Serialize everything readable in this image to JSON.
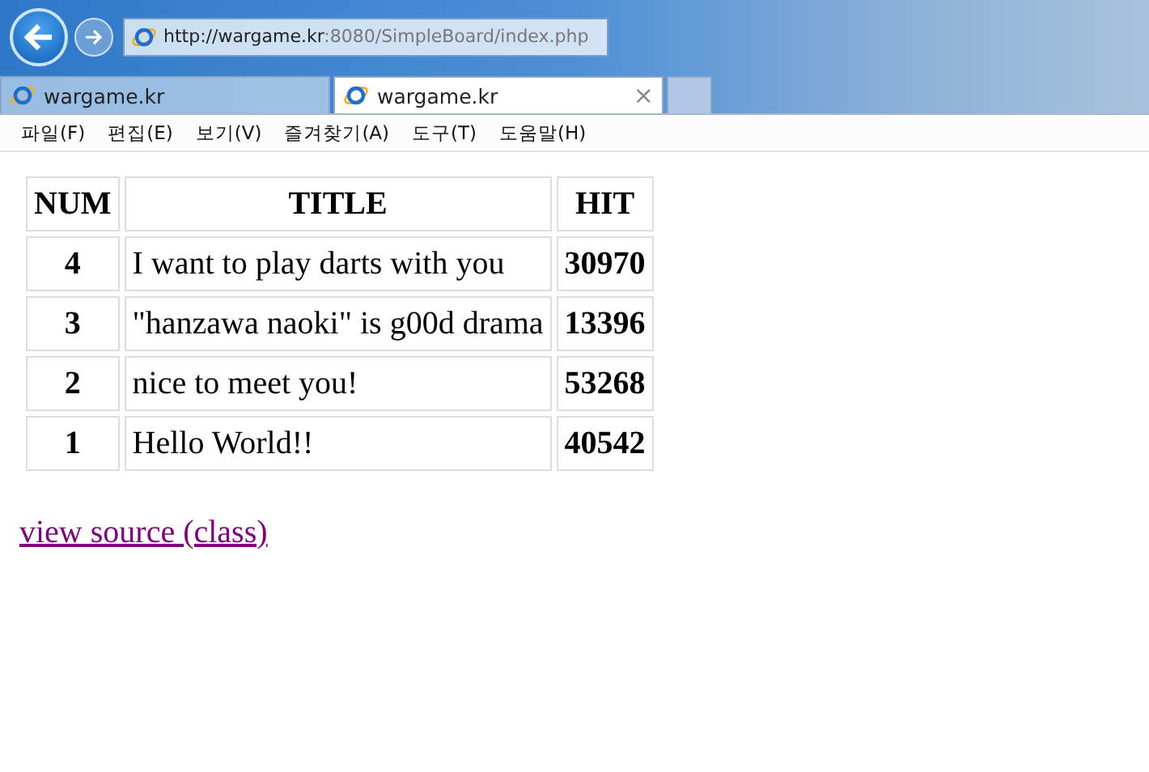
{
  "address_bar": {
    "url_host": "http://wargame.kr",
    "url_rest": ":8080/SimpleBoard/index.php"
  },
  "tabs": [
    {
      "label": "wargame.kr",
      "selected": false
    },
    {
      "label": "wargame.kr",
      "selected": true,
      "close": "×"
    }
  ],
  "menu": [
    "파일(F)",
    "편집(E)",
    "보기(V)",
    "즐겨찾기(A)",
    "도구(T)",
    "도움말(H)"
  ],
  "table": {
    "columns": [
      "NUM",
      "TITLE",
      "HIT"
    ],
    "rows": [
      [
        "4",
        "I want to play darts with you",
        "30970"
      ],
      [
        "3",
        "\"hanzawa naoki\" is g00d drama",
        "13396"
      ],
      [
        "2",
        "nice to meet you!",
        "53268"
      ],
      [
        "1",
        "Hello World!!",
        "40542"
      ]
    ]
  },
  "link": "view source (class)"
}
